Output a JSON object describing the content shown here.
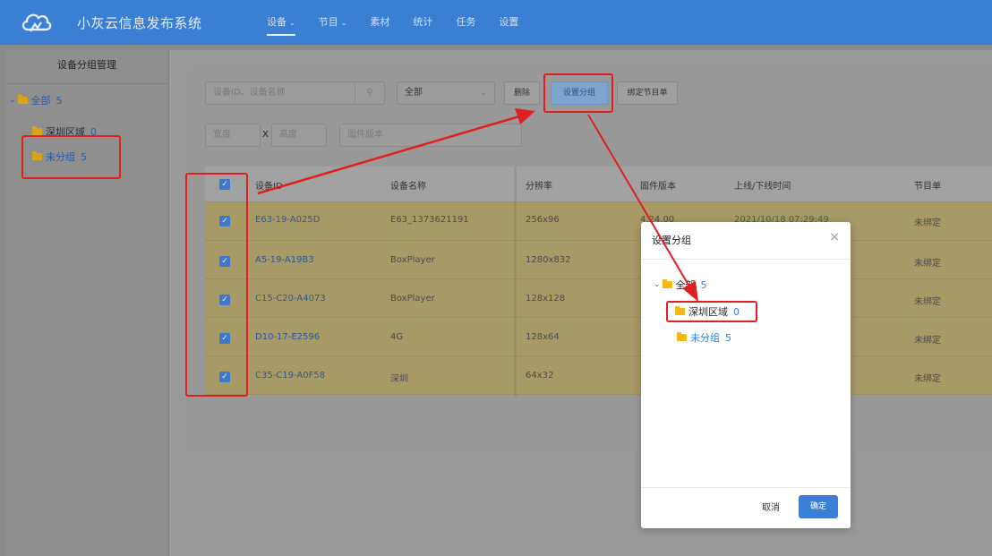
{
  "app": {
    "brand": "小灰云信息发布系统",
    "nav": [
      {
        "label": "设备",
        "has_caret": true,
        "active": true
      },
      {
        "label": "节目",
        "has_caret": true,
        "active": false
      },
      {
        "label": "素材",
        "has_caret": false,
        "active": false
      },
      {
        "label": "统计",
        "has_caret": false,
        "active": false
      },
      {
        "label": "任务",
        "has_caret": false,
        "active": false
      },
      {
        "label": "设置",
        "has_caret": false,
        "active": false
      }
    ],
    "caret": "⌄"
  },
  "sidebar": {
    "title": "设备分组管理",
    "tree": {
      "root": {
        "label": "全部",
        "count": "5",
        "toggle": "⌄"
      },
      "children": [
        {
          "label": "深圳区域",
          "count": "0"
        },
        {
          "label": "未分组",
          "count": "5"
        }
      ]
    }
  },
  "toolbar": {
    "search_placeholder": "设备ID、设备名称",
    "search_icon": "⚲",
    "status_select": "全部",
    "select_caret": "⌄",
    "delete_label": "删除",
    "set_group_label": "设置分组",
    "bind_playlist_label": "绑定节目单",
    "width_placeholder": "宽度",
    "times": "X",
    "height_placeholder": "高度",
    "firmware_placeholder": "固件版本"
  },
  "table": {
    "columns": [
      "设备ID",
      "设备名称",
      "分辨率",
      "固件版本",
      "上线/下线时间",
      "节目单"
    ],
    "rows": [
      {
        "id": "E63-19-A025D",
        "name": "E63_1373621191",
        "resolution": "256x96",
        "firmware": "4.24.00",
        "online": "2021/10/18 07:29:49",
        "playlist": "未绑定"
      },
      {
        "id": "A5-19-A19B3",
        "name": "BoxPlayer",
        "resolution": "1280x832",
        "firmware": "",
        "online": "",
        "playlist": "未绑定"
      },
      {
        "id": "C15-C20-A4073",
        "name": "BoxPlayer",
        "resolution": "128x128",
        "firmware": "",
        "online": "",
        "playlist": "未绑定"
      },
      {
        "id": "D10-17-E2596",
        "name": "4G",
        "resolution": "128x64",
        "firmware": "",
        "online": "",
        "playlist": "未绑定"
      },
      {
        "id": "C35-C19-A0F58",
        "name": "深圳",
        "resolution": "64x32",
        "firmware": "",
        "online": "",
        "playlist": "未绑定"
      }
    ],
    "check_mark": "✓"
  },
  "dialog": {
    "title": "设置分组",
    "close": "×",
    "tree": {
      "root": {
        "label": "全部",
        "count": "5",
        "toggle": "⌄"
      },
      "children": [
        {
          "label": "深圳区域",
          "count": "0"
        },
        {
          "label": "未分组",
          "count": "5"
        }
      ]
    },
    "cancel_label": "取消",
    "ok_label": "确定"
  },
  "colors": {
    "topbar": "#3a7fd3",
    "highlight": "#e02020",
    "primary": "#3a80d8",
    "folder": "#f6b816"
  }
}
